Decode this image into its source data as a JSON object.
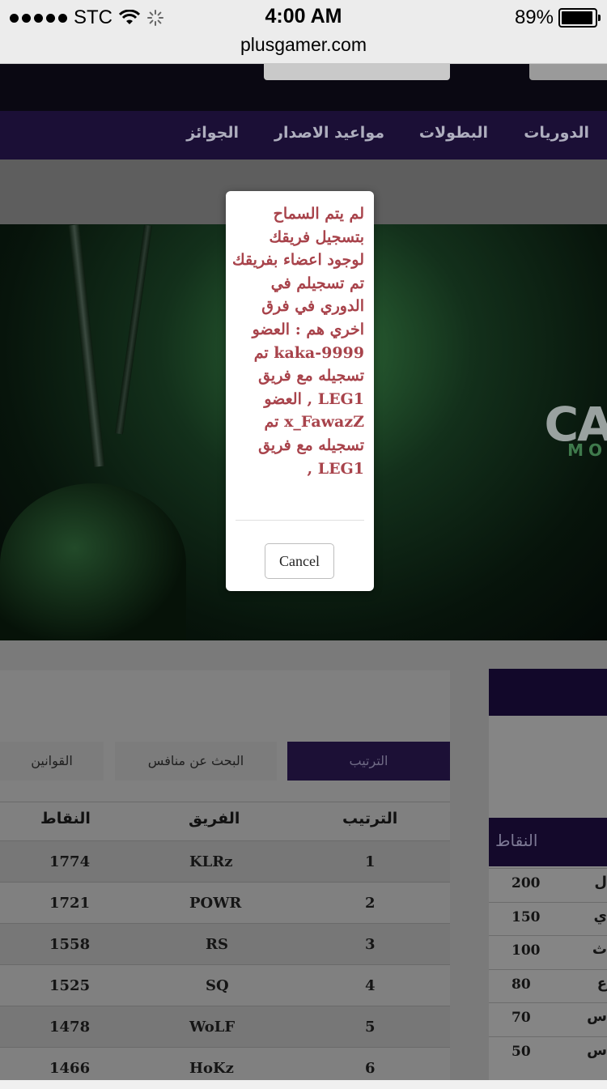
{
  "status_bar": {
    "carrier": "STC",
    "time": "4:00 AM",
    "battery": "89%",
    "battery_level": 0.89,
    "url": "plusgamer.com"
  },
  "nav": {
    "items": [
      "الدوريات",
      "البطولات",
      "مواعيد الاصدار",
      "الجوائز"
    ]
  },
  "hero": {
    "logo_text": "CA",
    "logo_sub": "MO"
  },
  "tabs": [
    "الترتيب",
    "البحث عن منافس",
    "القوانين"
  ],
  "standings": {
    "headers": {
      "rank": "الترتيب",
      "team": "الفريق",
      "points": "النقاط"
    },
    "rows": [
      {
        "rank": "1",
        "team": "KLRz",
        "points": "1774"
      },
      {
        "rank": "2",
        "team": "POWR",
        "points": "1721"
      },
      {
        "rank": "3",
        "team": "RS",
        "points": "1558"
      },
      {
        "rank": "4",
        "team": "SQ",
        "points": "1525"
      },
      {
        "rank": "5",
        "team": "WoLF",
        "points": "1478"
      },
      {
        "rank": "6",
        "team": "HoKz",
        "points": "1466"
      }
    ]
  },
  "side_table": {
    "header": "النقاط",
    "rows": [
      {
        "points": "200",
        "label": "ل"
      },
      {
        "points": "150",
        "label": "ي"
      },
      {
        "points": "100",
        "label": "ث"
      },
      {
        "points": "80",
        "label": "ع"
      },
      {
        "points": "70",
        "label": "س"
      },
      {
        "points": "50",
        "label": "س"
      }
    ]
  },
  "dialog": {
    "message": "لم يتم السماح بتسجيل فريقك لوجود اعضاء بفريقك تم تسجيلم في الدوري في فرق اخري هم : العضو kaka-9999 تم تسجيله مع فريق LEG1 , العضو x_FawazZ تم تسجيله مع فريق LEG1 ,",
    "cancel_label": "Cancel"
  },
  "colors": {
    "nav_bg": "#1b0f36",
    "dialog_text": "#a8434b"
  }
}
